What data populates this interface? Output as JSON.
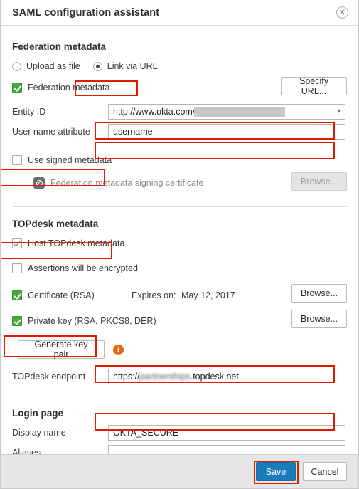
{
  "dialog": {
    "title": "SAML configuration assistant",
    "close_icon": "close-circle-icon"
  },
  "federation": {
    "section_title": "Federation metadata",
    "radio_upload_label": "Upload as file",
    "radio_url_label": "Link via URL",
    "radio_selected": "Link via URL",
    "checkbox_federation_metadata_label": "Federation metadata",
    "checkbox_federation_metadata_checked": "true",
    "specify_url_button": "Specify URL...",
    "entity_id_label": "Entity ID",
    "entity_id_value": "http://www.okta.com/",
    "entity_id_redacted": "true",
    "user_name_attribute_label": "User name attribute",
    "user_name_attribute_value": "username",
    "use_signed_metadata_label": "Use signed metadata",
    "use_signed_metadata_checked": "false",
    "signing_certificate_label": "Federation metadata signing certificate",
    "signing_certificate_browse": "Browse...",
    "signing_certificate_disabled": "true"
  },
  "topdesk": {
    "section_title": "TOPdesk metadata",
    "host_metadata_label": "Host TOPdesk metadata",
    "host_metadata_checked": "true",
    "assertions_encrypted_label": "Assertions will be encrypted",
    "assertions_encrypted_checked": "false",
    "certificate_label": "Certificate (RSA)",
    "certificate_checked": "true",
    "expires_on_label": "Expires on:",
    "expires_on_value": "May 12, 2017",
    "certificate_browse": "Browse...",
    "private_key_label": "Private key (RSA, PKCS8, DER)",
    "private_key_checked": "true",
    "private_key_browse": "Browse...",
    "generate_key_pair_button": "Generate key pair",
    "info_icon": "info-icon",
    "endpoint_label": "TOPdesk endpoint",
    "endpoint_prefix": "https://",
    "endpoint_blurred": "partnerships",
    "endpoint_suffix": ".topdesk.net"
  },
  "login_page": {
    "section_title": "Login page",
    "display_name_label": "Display name",
    "display_name_value": "OKTA_SECURE",
    "aliases_label": "Aliases",
    "aliases_value": ""
  },
  "footer": {
    "save_label": "Save",
    "cancel_label": "Cancel"
  },
  "colors": {
    "annotation": "#e01b00",
    "primary_button": "#1a7bbd",
    "checkbox_green": "#46aa3c",
    "info_orange": "#e8690b"
  }
}
